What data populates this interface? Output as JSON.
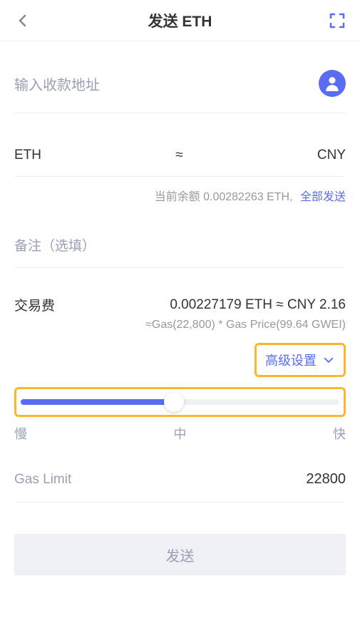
{
  "header": {
    "title": "发送 ETH"
  },
  "address": {
    "placeholder": "输入收款地址"
  },
  "amount": {
    "base_currency": "ETH",
    "approx_symbol": "≈",
    "quote_currency": "CNY"
  },
  "balance": {
    "text": "当前余额 0.00282263 ETH,",
    "send_all": "全部发送"
  },
  "memo": {
    "placeholder": "备注（选填）"
  },
  "fee": {
    "label": "交易费",
    "value": "0.00227179 ETH ≈ CNY 2.16",
    "formula": "≈Gas(22,800) * Gas Price(99.64 GWEI)"
  },
  "advanced": {
    "label": "高级设置"
  },
  "slider": {
    "slow": "慢",
    "medium": "中",
    "fast": "快"
  },
  "gas_limit": {
    "label": "Gas Limit",
    "value": "22800"
  },
  "send_button": "发送"
}
